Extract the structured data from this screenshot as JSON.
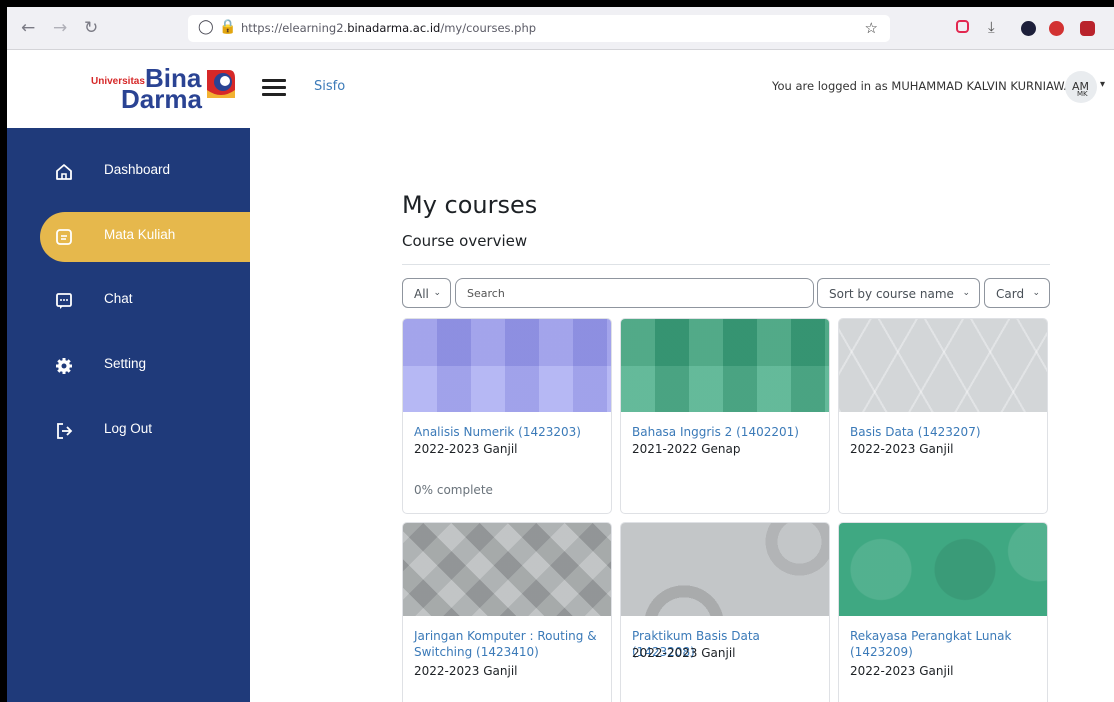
{
  "browser": {
    "url_prefix": "https://elearning2.",
    "url_domain": "binadarma.ac.id",
    "url_path": "/my/courses.php",
    "icons": [
      "back-icon",
      "forward-icon",
      "reload-icon",
      "shield-icon",
      "lock-icon",
      "bookmark-star-icon",
      "pocket-icon",
      "download-icon",
      "extension-icon",
      "adblock-icon",
      "ublock-icon"
    ]
  },
  "header": {
    "logo_small": "Universitas",
    "logo_bina": "Bina",
    "logo_darma": "Darma",
    "nav_link": "Sisfo",
    "logged_in_text": "You are logged in as MUHAMMAD KALVIN KURNIAWAN",
    "avatar_initials": "AM",
    "avatar_sub": "MK"
  },
  "sidebar": {
    "items": [
      {
        "label": "Dashboard",
        "icon": "home-icon"
      },
      {
        "label": "Mata Kuliah",
        "icon": "file-icon",
        "active": true
      },
      {
        "label": "Chat",
        "icon": "chat-icon"
      },
      {
        "label": "Setting",
        "icon": "gear-icon"
      },
      {
        "label": "Log Out",
        "icon": "logout-icon"
      }
    ]
  },
  "main": {
    "title": "My courses",
    "subtitle": "Course overview",
    "filter": "All",
    "search_placeholder": "Search",
    "sort": "Sort by course name",
    "view": "Card"
  },
  "courses": [
    {
      "name": "Analisis Numerik (1423203)",
      "term": "2022-2023 Ganjil",
      "progress": "0% complete",
      "color": "#9fa1f0"
    },
    {
      "name": "Bahasa Inggris 2 (1402201)",
      "term": "2021-2022 Genap",
      "color": "#3fa882"
    },
    {
      "name": "Basis Data (1423207)",
      "term": "2022-2023 Ganjil",
      "color": "#cfd3d6"
    },
    {
      "name": "Jaringan Komputer : Routing & Switching (1423410)",
      "term": "2022-2023 Ganjil",
      "color": "#a9adaf"
    },
    {
      "name": "Praktikum Basis Data (1423208)",
      "term": "2022-2023 Ganjil",
      "color": "#c0c3c5"
    },
    {
      "name": "Rekayasa Perangkat Lunak (1423209)",
      "term": "2022-2023 Ganjil",
      "color": "#3fa882"
    }
  ],
  "colors": {
    "sidebar": "#1f3a7a",
    "active": "#e6b84c",
    "link": "#3b7ab8"
  }
}
